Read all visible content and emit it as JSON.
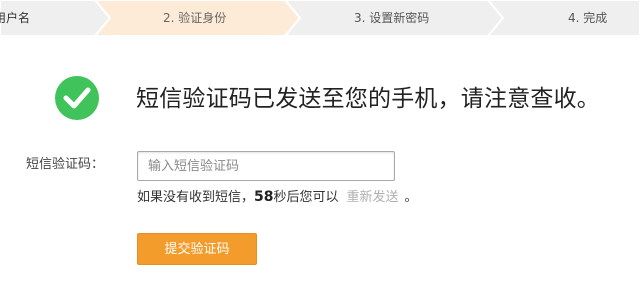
{
  "steps": [
    {
      "label": "用户名",
      "state": "done"
    },
    {
      "label": "2. 验证身份",
      "state": "active"
    },
    {
      "label": "3. 设置新密码",
      "state": "pending"
    },
    {
      "label": "4. 完成",
      "state": "pending"
    }
  ],
  "colors": {
    "step_active_bg": "#fdebd8",
    "step_inactive_bg": "#efefef",
    "success_green": "#3fc35a",
    "submit_orange": "#f39c2b",
    "link_gray": "#b0b0b0"
  },
  "success": {
    "icon": "check-circle-icon",
    "message": "短信验证码已发送至您的手机，请注意查收。"
  },
  "form": {
    "code_label": "短信验证码：",
    "code_placeholder": "输入短信验证码",
    "code_value": "",
    "resend_prefix": "如果没有收到短信，",
    "countdown": "58",
    "resend_middle": "秒后您可以",
    "resend_link": "重新发送",
    "resend_suffix": "。",
    "submit_label": "提交验证码"
  }
}
